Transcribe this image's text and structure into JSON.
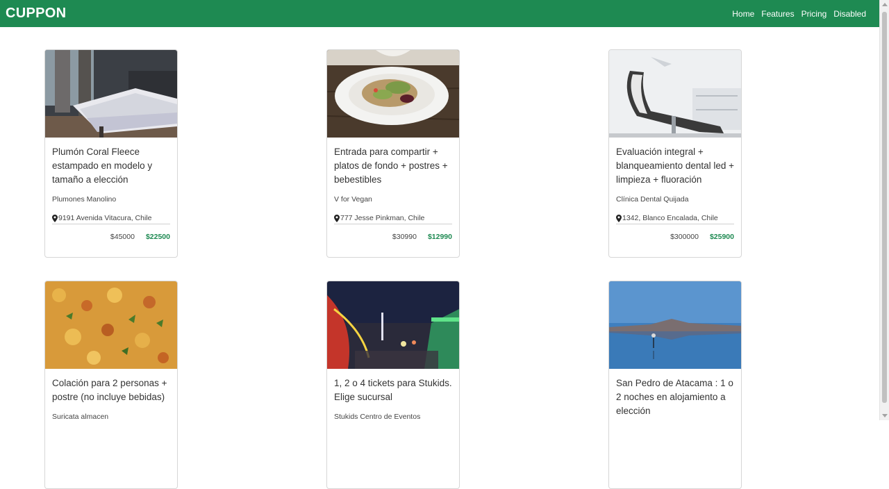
{
  "navbar": {
    "brand": "CUPPON",
    "links": [
      "Home",
      "Features",
      "Pricing",
      "Disabled"
    ]
  },
  "colors": {
    "primary": "#1e8a52",
    "price_new": "#1e8a52"
  },
  "cards": [
    {
      "image": "bedroom-photo",
      "title": "Plumón Coral Fleece estampado en modelo y tamaño a elección",
      "merchant": "Plumones Manolino",
      "address": "9191 Avenida Vitacura, Chile",
      "price_old": "$45000",
      "price_new": "$22500"
    },
    {
      "image": "salad-plate-photo",
      "title": "Entrada para compartir + platos de fondo + postres + bebestibles",
      "merchant": "V for Vegan",
      "address": " 777 Jesse Pinkman, Chile",
      "price_old": "$30990",
      "price_new": "$12990"
    },
    {
      "image": "dental-chair-photo",
      "title": "Evaluación integral + blanqueamiento dental led + limpieza + fluoración",
      "merchant": "Clínica Dental Quijada",
      "address": "1342, Blanco Encalada, Chile",
      "price_old": "$300000",
      "price_new": "$25900"
    },
    {
      "image": "rice-dish-photo",
      "title": "Colación para 2 personas + postre (no incluye bebidas)",
      "merchant": "Suricata almacen"
    },
    {
      "image": "amusement-park-photo",
      "title": "1, 2 o 4 tickets para Stukids. Elige sucursal",
      "merchant": "Stukids Centro de Eventos"
    },
    {
      "image": "atacama-lake-photo",
      "title": "San Pedro de Atacama : 1 o 2 noches en alojamiento a elección"
    }
  ]
}
